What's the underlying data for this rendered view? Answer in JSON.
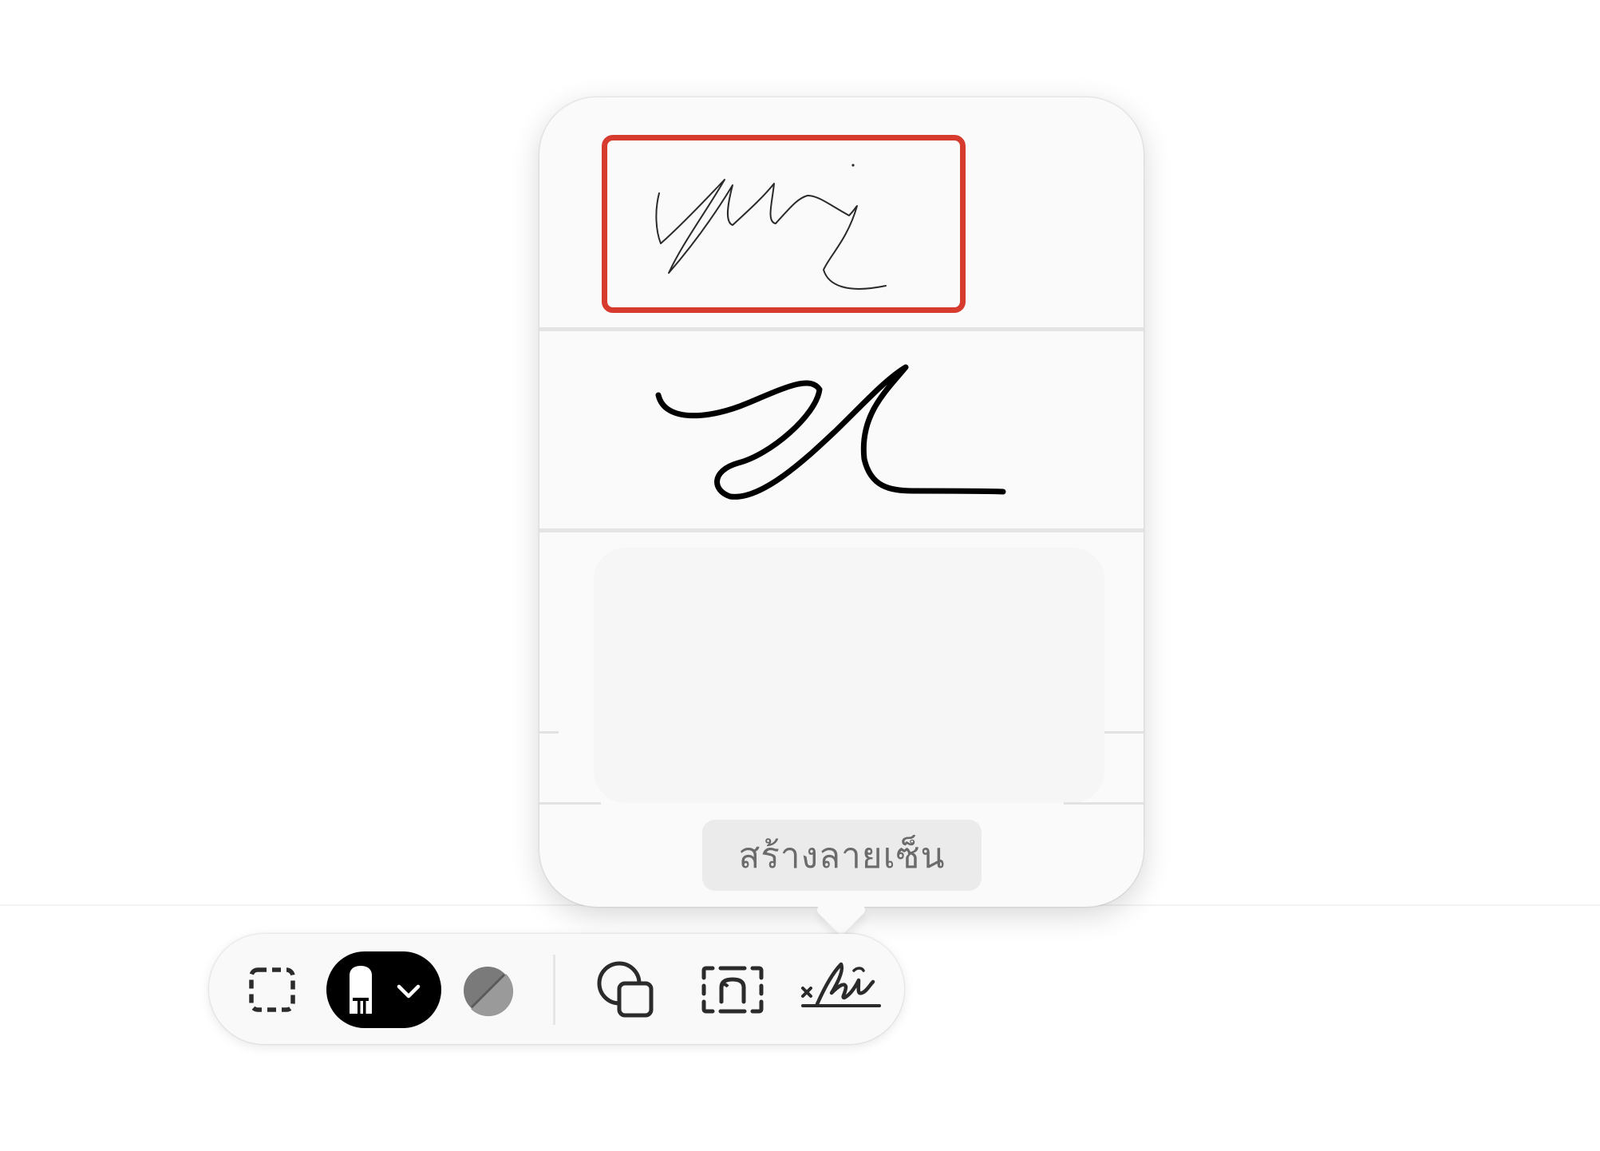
{
  "popover": {
    "create_signature_label": "สร้างลายเซ็น",
    "signatures": [
      {
        "name": "signature-1",
        "selected": true
      },
      {
        "name": "signature-2",
        "selected": false
      }
    ],
    "highlight_color": "#d63b2e"
  },
  "toolbar": {
    "items": [
      {
        "icon": "selection-rect-icon",
        "label": ""
      },
      {
        "icon": "draw-tool-icon",
        "label": "",
        "active": true
      },
      {
        "icon": "color-picker-icon",
        "label": ""
      },
      {
        "icon": "shapes-icon",
        "label": ""
      },
      {
        "icon": "text-box-icon",
        "label": ""
      },
      {
        "icon": "signature-icon",
        "label": ""
      }
    ]
  }
}
